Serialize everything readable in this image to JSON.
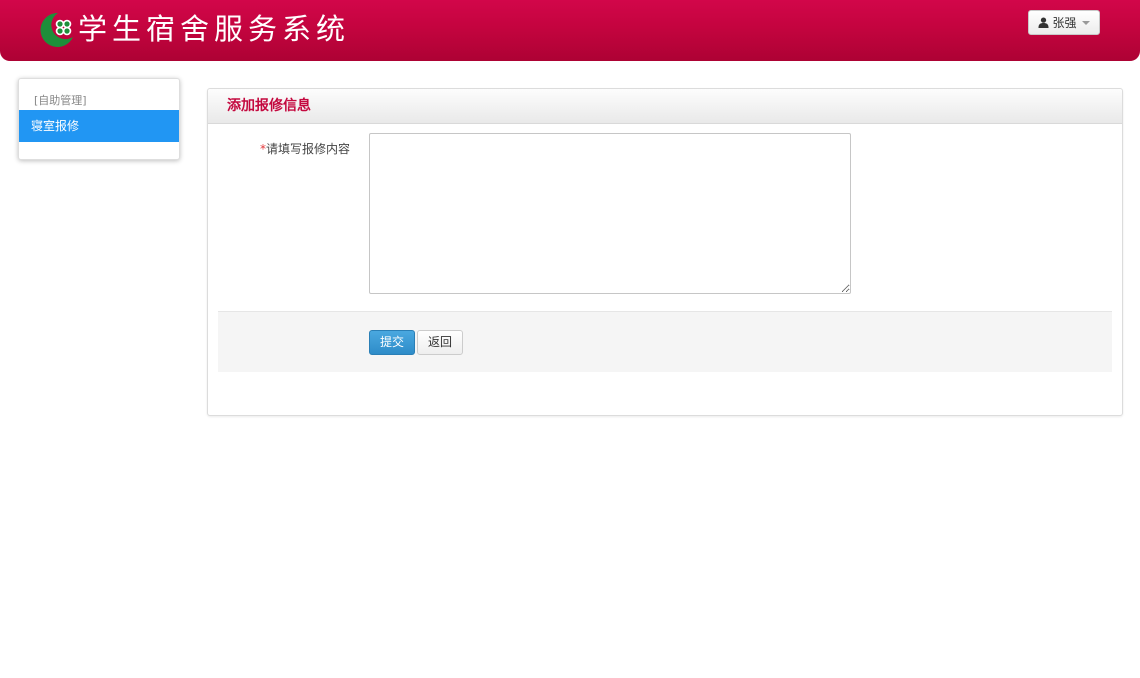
{
  "header": {
    "app_title": "学生宿舍服务系统",
    "logo_icon": "crescent-clover-logo",
    "user_name": "张强",
    "user_icon": "user-icon",
    "brand_color": "#c4043f"
  },
  "sidebar": {
    "heading": "[自助管理]",
    "items": [
      {
        "label": "寝室报修",
        "active": true
      }
    ],
    "active_color": "#2196f3"
  },
  "main": {
    "panel_title": "添加报修信息",
    "form": {
      "required_mark": "*",
      "content_label": "请填写报修内容",
      "content_value": ""
    },
    "buttons": {
      "submit_label": "提交",
      "back_label": "返回"
    }
  }
}
